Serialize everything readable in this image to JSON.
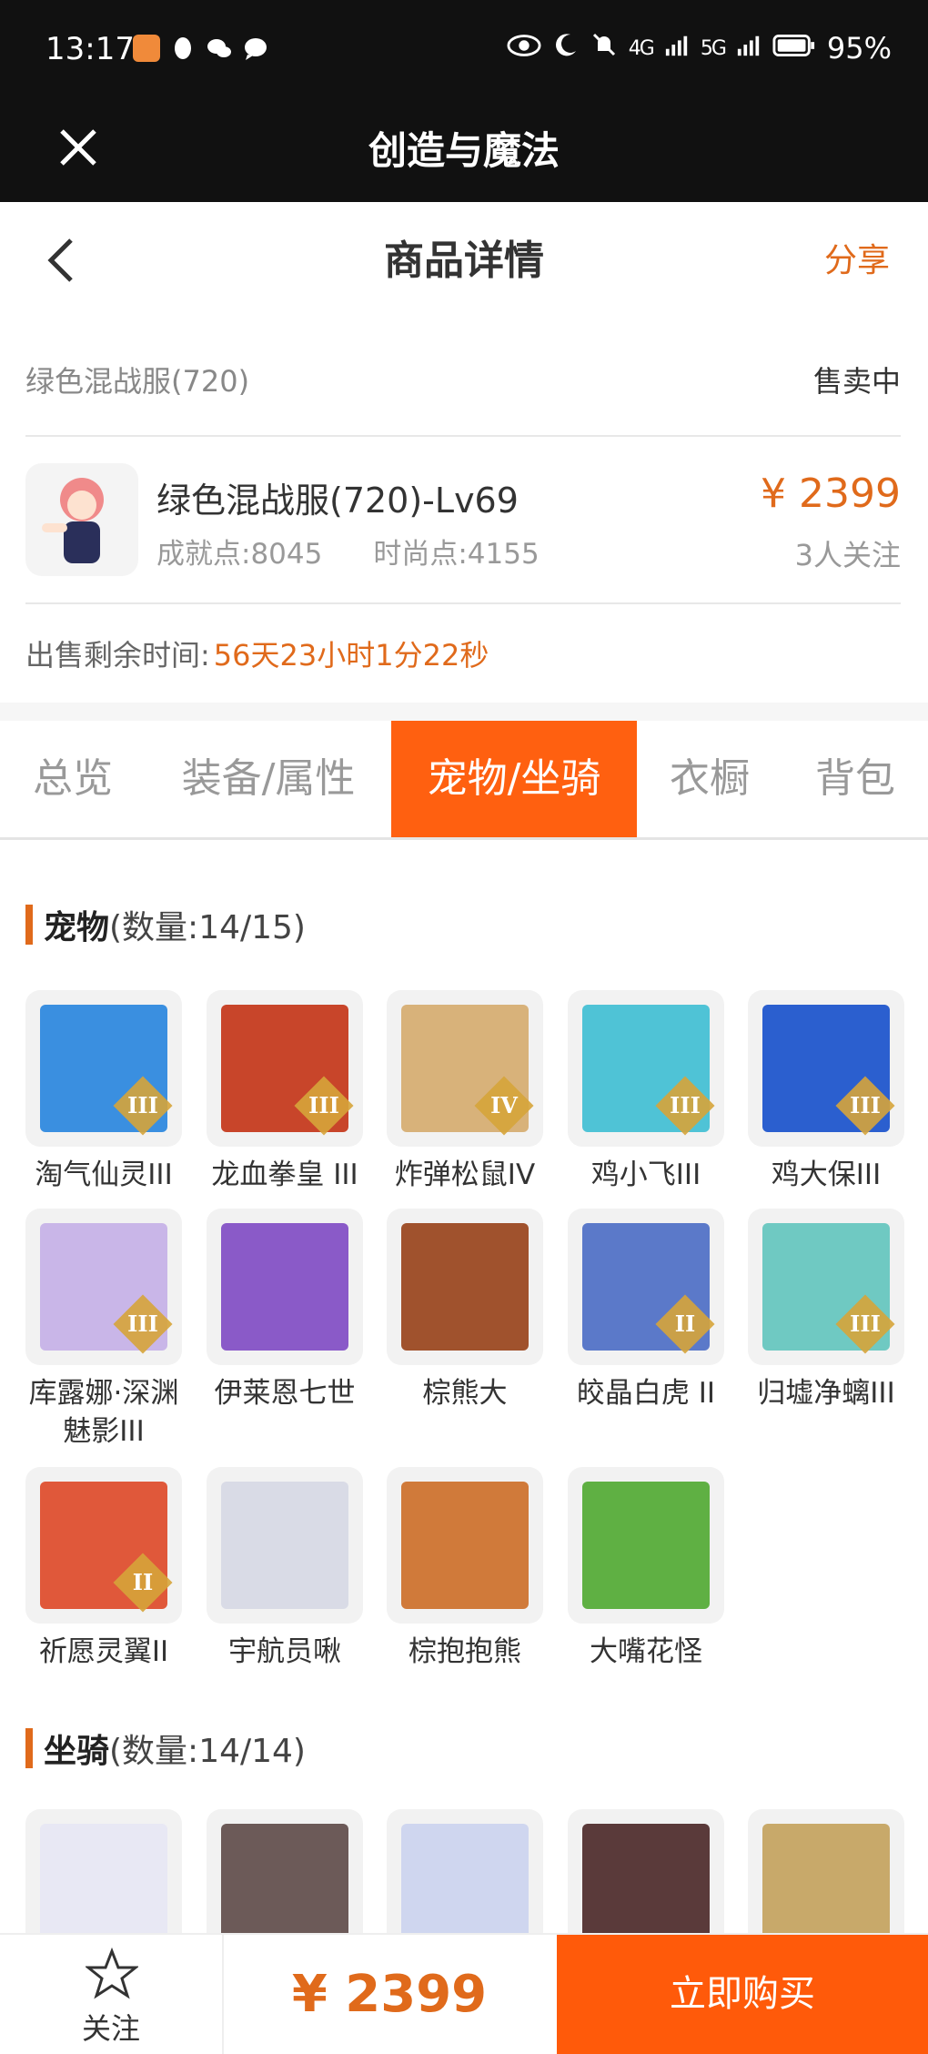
{
  "status_bar": {
    "time": "13:17",
    "battery": "95%",
    "network_1": "4G",
    "network_2": "5G"
  },
  "title_bar": {
    "title": "创造与魔法"
  },
  "nav": {
    "heading": "商品详情",
    "share_label": "分享"
  },
  "listing": {
    "item_name": "绿色混战服(720)",
    "status": "售卖中",
    "product_title": "绿色混战服(720)-Lv69",
    "achievement": "成就点:8045",
    "fashion": "时尚点:4155",
    "price": "¥ 2399",
    "followers": "3人关注",
    "time_label": "出售剩余时间:",
    "time_value": "56天23小时1分22秒"
  },
  "tabs": [
    "总览",
    "装备/属性",
    "宠物/坐骑",
    "衣橱",
    "背包"
  ],
  "pets_section": {
    "title": "宠物",
    "count": "(数量:14/15)"
  },
  "pets": [
    {
      "name": "淘气仙灵III",
      "tier": "III",
      "color": "#3a8fe0"
    },
    {
      "name": "龙血拳皇 III",
      "tier": "III",
      "color": "#c8452a"
    },
    {
      "name": "炸弹松鼠IV",
      "tier": "IV",
      "color": "#d8b27a"
    },
    {
      "name": "鸡小飞III",
      "tier": "III",
      "color": "#4fc3d6"
    },
    {
      "name": "鸡大保III",
      "tier": "III",
      "color": "#2b5fcf"
    },
    {
      "name": "库露娜·深渊魅影III",
      "tier": "III",
      "color": "#c9b6e8"
    },
    {
      "name": "伊莱恩七世",
      "tier": "",
      "color": "#8a5ac8"
    },
    {
      "name": "棕熊大",
      "tier": "",
      "color": "#a0522d"
    },
    {
      "name": "皎晶白虎 II",
      "tier": "II",
      "color": "#5b79c9"
    },
    {
      "name": "归墟净螭III",
      "tier": "III",
      "color": "#6fc9c2"
    },
    {
      "name": "祈愿灵翼II",
      "tier": "II",
      "color": "#e0583a"
    },
    {
      "name": "宇航员啾",
      "tier": "",
      "color": "#d9dbe6"
    },
    {
      "name": "棕抱抱熊",
      "tier": "",
      "color": "#d07a3a"
    },
    {
      "name": "大嘴花怪",
      "tier": "",
      "color": "#5fb043"
    }
  ],
  "mounts_section": {
    "title": "坐骑",
    "count": "(数量:14/14)"
  },
  "mounts": [
    {
      "color": "#e8e8f4"
    },
    {
      "color": "#6c5a58"
    },
    {
      "color": "#cfd6ef"
    },
    {
      "color": "#5a3a3a"
    },
    {
      "color": "#c8a96a"
    }
  ],
  "bottom": {
    "follow_label": "关注",
    "price": "¥ 2399",
    "buy_label": "立即购买"
  }
}
